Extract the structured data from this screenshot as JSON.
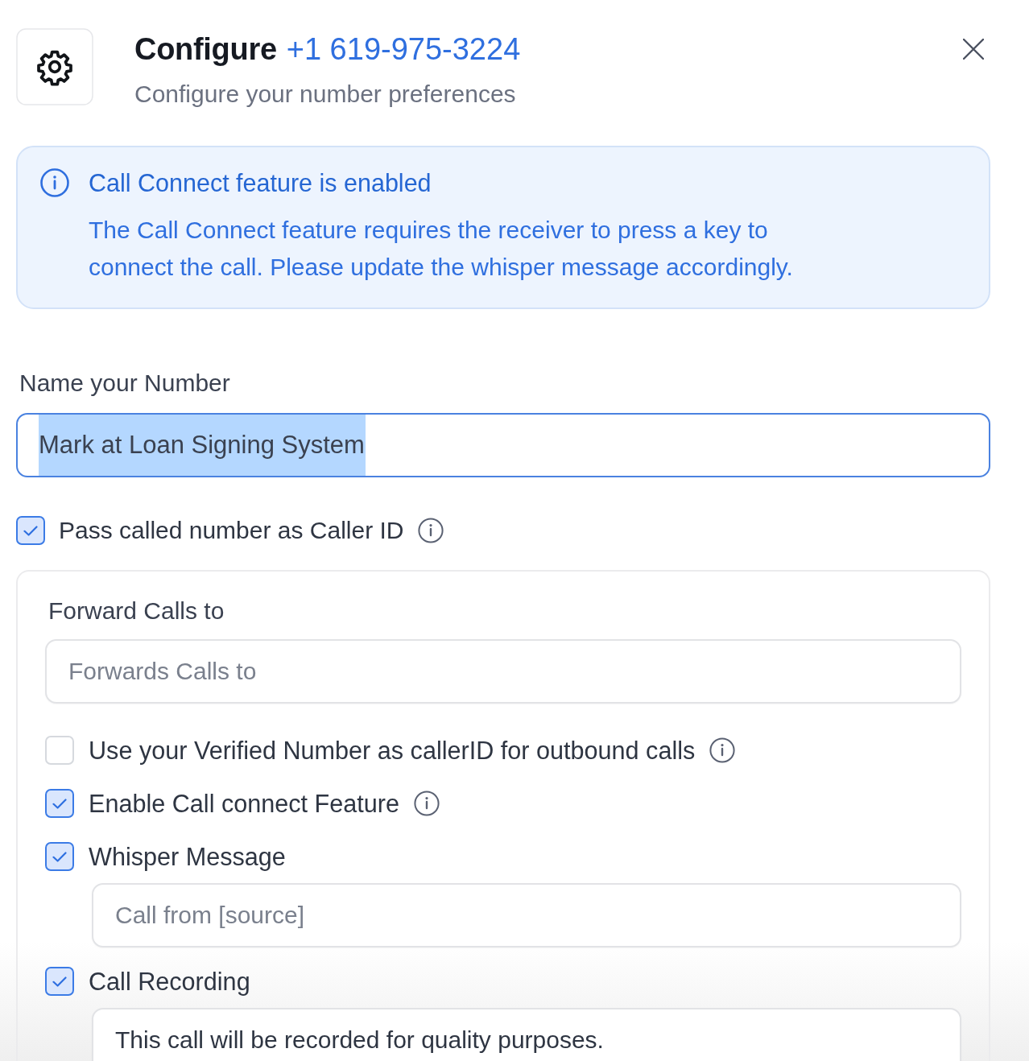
{
  "header": {
    "title": "Configure",
    "phone_number": "+1 619-975-3224",
    "subtitle": "Configure your number preferences"
  },
  "alert": {
    "title": "Call Connect feature is enabled",
    "message": "The Call Connect feature requires the receiver to press a key to connect the call. Please update the whisper message accordingly."
  },
  "name_field": {
    "label": "Name your Number",
    "value": "Mark at Loan Signing System",
    "focused": true,
    "text_selected": true
  },
  "pass_caller_id": {
    "label": "Pass called number as Caller ID",
    "checked": true,
    "info": true
  },
  "forwarding": {
    "label": "Forward Calls to",
    "placeholder": "Forwards Calls to",
    "options": [
      {
        "label": "Use your Verified Number as callerID for outbound calls",
        "checked": false,
        "info": true
      },
      {
        "label": "Enable Call connect Feature",
        "checked": true,
        "info": true
      },
      {
        "label": "Whisper Message",
        "checked": true,
        "field": {
          "placeholder": "Call from [source]"
        }
      },
      {
        "label": "Call Recording",
        "checked": true,
        "field": {
          "value": "This call will be recorded for quality purposes."
        }
      }
    ]
  }
}
